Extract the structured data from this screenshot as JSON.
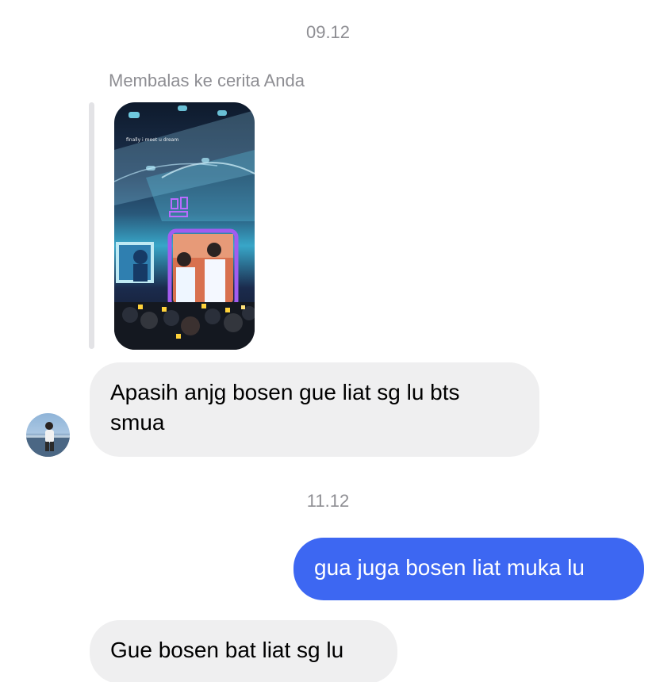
{
  "conversation": {
    "timestamp_1": "09.12",
    "reply_label": "Membalas ke cerita Anda",
    "story": {
      "icon": "story-thumbnail-image",
      "caption_text": "finally i meet u dream"
    },
    "messages": [
      {
        "side": "received",
        "text": "Apasih anjg bosen gue liat sg lu bts smua"
      },
      {
        "side": "sent",
        "text": "gua juga bosen liat muka lu"
      },
      {
        "side": "received",
        "text": "Gue bosen bat liat sg lu"
      }
    ],
    "timestamp_2": "11.12"
  },
  "colors": {
    "sent_bubble": "#3d67f2",
    "received_bubble": "#efeff0",
    "timestamp_text": "#8e8e93"
  }
}
